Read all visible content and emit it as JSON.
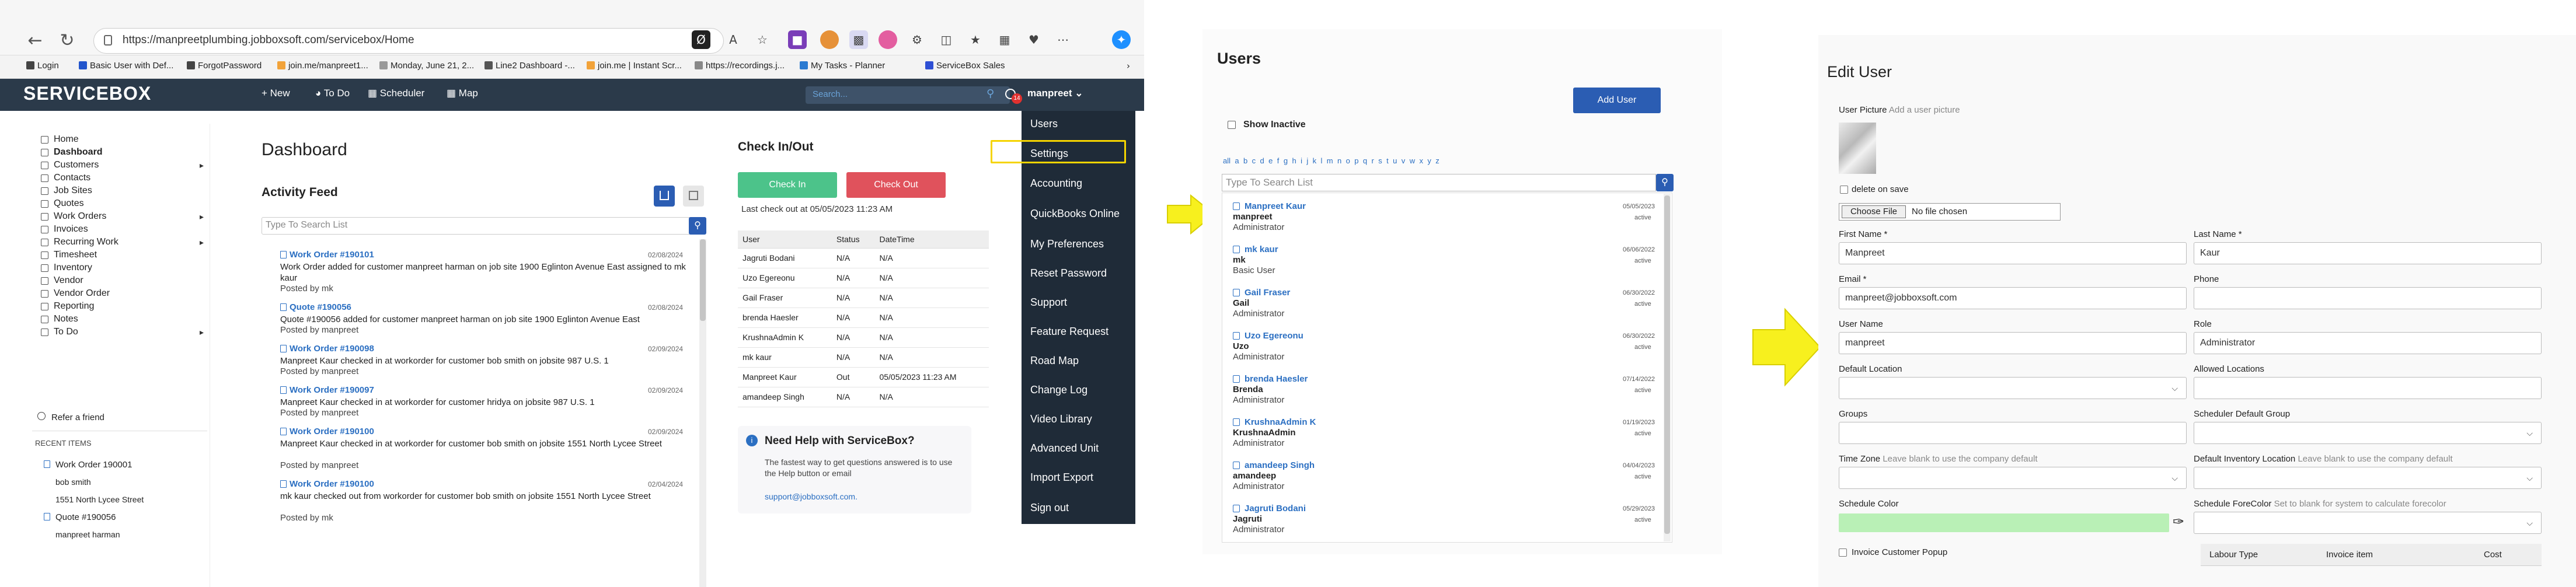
{
  "browser": {
    "url": "https://manpreetplumbing.jobboxsoft.com/servicebox/Home",
    "bookmarks": [
      "Login",
      "Basic User with Def...",
      "ForgotPassword",
      "join.me/manpreet1...",
      "Monday, June 21, 2...",
      "Line2 Dashboard -...",
      "join.me | Instant Scr...",
      "https://recordings.j...",
      "My Tasks - Planner",
      "ServiceBox Sales"
    ]
  },
  "app": {
    "logo": "SERVICEBOX",
    "nav": [
      {
        "label": "+ New"
      },
      {
        "label": "To Do"
      },
      {
        "label": "Scheduler"
      },
      {
        "label": "Map"
      }
    ],
    "search_placeholder": "Search...",
    "user_name": "manpreet",
    "notification_count": "14"
  },
  "sidebar": {
    "items": [
      "Home",
      "Dashboard",
      "Customers",
      "Contacts",
      "Job Sites",
      "Quotes",
      "Work Orders",
      "Invoices",
      "Recurring Work",
      "Timesheet",
      "Inventory",
      "Vendor",
      "Vendor Order",
      "Reporting",
      "Notes",
      "To Do"
    ],
    "refer": "Refer a friend",
    "recent_header": "RECENT ITEMS",
    "recent": [
      "Work Order 190001",
      "bob smith",
      "1551 North Lycee Street",
      "Quote #190056",
      "manpreet harman"
    ]
  },
  "dashboard": {
    "title": "Dashboard",
    "activity_title": "Activity Feed",
    "search_placeholder": "Type To Search List",
    "feed": [
      {
        "title": "Work Order #190101",
        "date": "02/08/2024",
        "text": "Work Order added for customer manpreet harman on job site 1900 Eglinton Avenue East assigned to mk kaur",
        "by": "Posted by mk"
      },
      {
        "title": "Quote #190056",
        "date": "02/08/2024",
        "text": "Quote #190056 added for customer manpreet harman on job site 1900 Eglinton Avenue East",
        "by": "Posted by manpreet"
      },
      {
        "title": "Work Order #190098",
        "date": "02/09/2024",
        "text": "Manpreet Kaur checked in at workorder for customer bob smith on jobsite 987 U.S. 1",
        "by": "Posted by manpreet"
      },
      {
        "title": "Work Order #190097",
        "date": "02/09/2024",
        "text": "Manpreet Kaur checked in at workorder for customer hridya on jobsite 987 U.S. 1",
        "by": "Posted by manpreet"
      },
      {
        "title": "Work Order #190100",
        "date": "02/09/2024",
        "text": "Manpreet Kaur checked in at workorder for customer bob smith on jobsite 1551 North Lycee Street",
        "by": "Posted by manpreet"
      },
      {
        "title": "Work Order #190100",
        "date": "02/04/2024",
        "text": "mk kaur checked out from workorder for customer bob smith on jobsite 1551 North Lycee Street",
        "by": "Posted by mk"
      }
    ]
  },
  "checkin": {
    "title": "Check In/Out",
    "check_in": "Check In",
    "check_out": "Check Out",
    "last": "Last check out at 05/05/2023 11:23 AM",
    "headers": [
      "User",
      "Status",
      "DateTime"
    ],
    "rows": [
      [
        "Jagruti Bodani",
        "N/A",
        "N/A"
      ],
      [
        "Uzo Egereonu",
        "N/A",
        "N/A"
      ],
      [
        "Gail Fraser",
        "N/A",
        "N/A"
      ],
      [
        "brenda Haesler",
        "N/A",
        "N/A"
      ],
      [
        "KrushnaAdmin K",
        "N/A",
        "N/A"
      ],
      [
        "mk kaur",
        "N/A",
        "N/A"
      ],
      [
        "Manpreet Kaur",
        "Out",
        "05/05/2023 11:23 AM"
      ],
      [
        "amandeep Singh",
        "N/A",
        "N/A"
      ]
    ],
    "help_title": "Need Help with ServiceBox?",
    "help_text": "The fastest way to get questions answered is to use the Help button or email",
    "help_email": "support@jobboxsoft.com."
  },
  "user_menu": [
    "Users",
    "Settings",
    "Accounting",
    "QuickBooks Online",
    "My Preferences",
    "Reset Password",
    "Support",
    "Feature Request",
    "Road Map",
    "Change Log",
    "Video Library",
    "Advanced Unit",
    "Import Export",
    "Sign out"
  ],
  "users_page": {
    "title": "Users",
    "add_button": "Add User",
    "show_inactive": "Show Inactive",
    "alpha": [
      "all",
      "a",
      "b",
      "c",
      "d",
      "e",
      "f",
      "g",
      "h",
      "i",
      "j",
      "k",
      "l",
      "m",
      "n",
      "o",
      "p",
      "q",
      "r",
      "s",
      "t",
      "u",
      "v",
      "w",
      "x",
      "y",
      "z"
    ],
    "search_placeholder": "Type To Search List",
    "users": [
      {
        "name": "Manpreet Kaur",
        "login": "manpreet",
        "role": "Administrator",
        "date": "05/05/2023",
        "status": "active"
      },
      {
        "name": "mk kaur",
        "login": "mk",
        "role": "Basic User",
        "date": "06/06/2022",
        "status": "active"
      },
      {
        "name": "Gail Fraser",
        "login": "Gail",
        "role": "Administrator",
        "date": "06/30/2022",
        "status": "active"
      },
      {
        "name": "Uzo Egereonu",
        "login": "Uzo",
        "role": "Administrator",
        "date": "06/30/2022",
        "status": "active"
      },
      {
        "name": "brenda Haesler",
        "login": "Brenda",
        "role": "Administrator",
        "date": "07/14/2022",
        "status": "active"
      },
      {
        "name": "KrushnaAdmin K",
        "login": "KrushnaAdmin",
        "role": "Administrator",
        "date": "01/19/2023",
        "status": "active"
      },
      {
        "name": "amandeep Singh",
        "login": "amandeep",
        "role": "Administrator",
        "date": "04/04/2023",
        "status": "active"
      },
      {
        "name": "Jagruti Bodani",
        "login": "Jagruti",
        "role": "Administrator",
        "date": "05/29/2023",
        "status": "active"
      }
    ]
  },
  "edit_user": {
    "title": "Edit User",
    "picture_label": "User Picture",
    "picture_hint": "Add a user picture",
    "delete_on_save": "delete on save",
    "choose_file": "Choose File",
    "no_file": "No file chosen",
    "first_name_label": "First Name *",
    "first_name": "Manpreet",
    "last_name_label": "Last Name *",
    "last_name": "Kaur",
    "email_label": "Email *",
    "email": "manpreet@jobboxsoft.com",
    "phone_label": "Phone",
    "username_label": "User Name",
    "username": "manpreet",
    "role_label": "Role",
    "role": "Administrator",
    "default_location_label": "Default Location",
    "allowed_locations_label": "Allowed Locations",
    "groups_label": "Groups",
    "scheduler_group_label": "Scheduler Default Group",
    "timezone_label": "Time Zone",
    "timezone_hint": "Leave blank to use the company default",
    "inventory_location_label": "Default Inventory Location",
    "inventory_location_hint": "Leave blank to use the company default",
    "schedule_color_label": "Schedule Color",
    "schedule_color": "#b9f0b6",
    "forecolor_label": "Schedule ForeColor",
    "forecolor_hint": "Set to blank for system to calculate forecolor",
    "invoice_popup": "Invoice Customer Popup",
    "labour_headers": [
      "Labour Type",
      "Invoice item",
      "Cost"
    ]
  },
  "colors": {
    "navbar": "#2b3a4a",
    "menu": "#1f2b38",
    "checkin": "#4cc38a",
    "checkout": "#e0525c",
    "link": "#2b6fc2",
    "highlight": "#f5d400",
    "arrow": "#f7f01e"
  }
}
